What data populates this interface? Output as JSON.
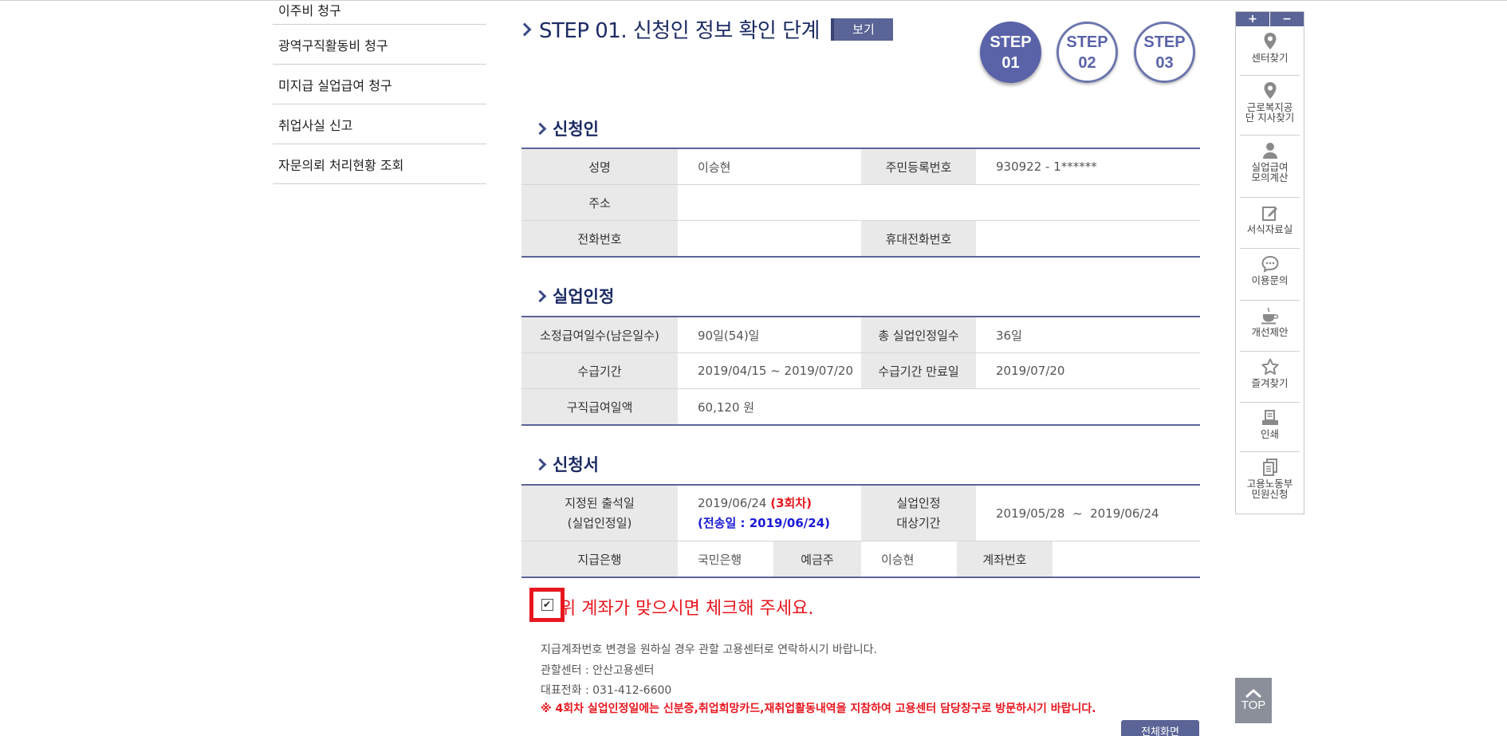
{
  "left_menu": {
    "items": [
      {
        "label": "이주비 청구"
      },
      {
        "label": "광역구직활동비 청구"
      },
      {
        "label": "미지급 실업급여 청구"
      },
      {
        "label": "취업사실 신고"
      },
      {
        "label": "자문의뢰 처리현황 조회"
      }
    ]
  },
  "step": {
    "title": "STEP 01. 신청인 정보 확인 단계",
    "view_button": "보기",
    "steps": [
      {
        "l1": "STEP",
        "l2": "01",
        "active": true
      },
      {
        "l1": "STEP",
        "l2": "02",
        "active": false
      },
      {
        "l1": "STEP",
        "l2": "03",
        "active": false
      }
    ]
  },
  "applicant": {
    "title": "신청인",
    "name_label": "성명",
    "name_value": "이승현",
    "rrn_label": "주민등록번호",
    "rrn_value": "930922 - 1******",
    "address_label": "주소",
    "address_value": "",
    "phone_label": "전화번호",
    "phone_value": "",
    "mobile_label": "휴대전화번호",
    "mobile_value": ""
  },
  "recognition": {
    "title": "실업인정",
    "days_label": "소정급여일수(남은일수)",
    "days_value": "90일(54)일",
    "total_label": "총 실업인정일수",
    "total_value": "36일",
    "period_label": "수급기간",
    "period_value": "2019/04/15 ~ 2019/07/20",
    "expiry_label": "수급기간 만료일",
    "expiry_value": "2019/07/20",
    "daily_label": "구직급여일액",
    "daily_value": "60,120 원"
  },
  "application": {
    "title": "신청서",
    "attend_label_1": "지정된 출석일",
    "attend_label_2": "(실업인정일)",
    "attend_date": "2019/06/24",
    "attend_round": "(3회차)",
    "attend_sent": "(전송일 : 2019/06/24)",
    "target_label_1": "실업인정",
    "target_label_2": "대상기간",
    "target_value": "2019/05/28  ~  2019/06/24",
    "bank_label": "지급은행",
    "bank_value": "국민은행",
    "holder_label": "예금주",
    "holder_value": "이승현",
    "account_label": "계좌번호",
    "account_value": ""
  },
  "confirm": {
    "checkbox_text": "위 계좌가 맞으시면 체크해 주세요.",
    "checked": true,
    "note_1": "지급계좌번호 변경을 원하실 경우 관할 고용센터로 연락하시기 바랍니다.",
    "note_2": "관할센터 : 안산고용센터",
    "note_3": "대표전화 : 031-412-6600",
    "warning": "※ 4회차 실업인정일에는 신분증,취업희망카드,재취업활동내역을 지참하여 고용센터 담당창구로 방문하시기 바랍니다.",
    "next_button": "전체화면"
  },
  "quick_bar": {
    "plus": "+",
    "minus": "−",
    "items": [
      {
        "label": "센터찾기",
        "icon": "map-pin-icon"
      },
      {
        "label": "근로복지공단 지사찾기",
        "icon": "map-pin-icon"
      },
      {
        "label": "실업급여 모의계산",
        "icon": "person-icon"
      },
      {
        "label": "서식자료실",
        "icon": "edit-icon"
      },
      {
        "label": "이용문의",
        "icon": "chat-icon"
      },
      {
        "label": "개선제안",
        "icon": "coffee-icon"
      },
      {
        "label": "즐겨찾기",
        "icon": "star-icon"
      },
      {
        "label": "인쇄",
        "icon": "print-icon"
      },
      {
        "label": "고용노동부 민원신청",
        "icon": "document-icon"
      }
    ]
  },
  "top_button": {
    "label": "TOP"
  },
  "colors": {
    "accent": "#5b6496",
    "title": "#1c2b63",
    "alert": "#e8171f"
  }
}
